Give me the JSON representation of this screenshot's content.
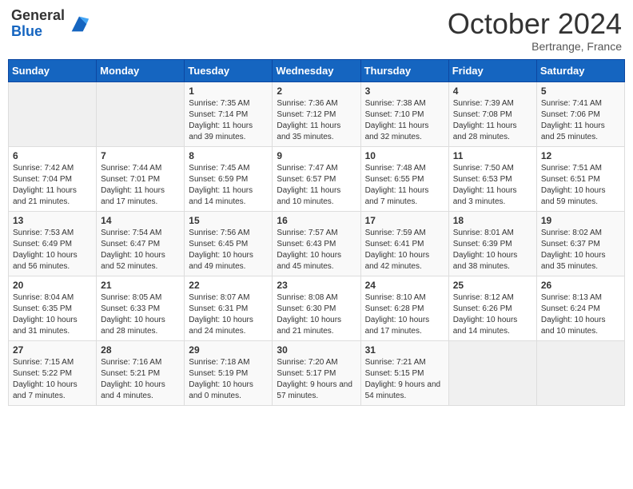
{
  "header": {
    "logo_general": "General",
    "logo_blue": "Blue",
    "month": "October 2024",
    "location": "Bertrange, France"
  },
  "days_of_week": [
    "Sunday",
    "Monday",
    "Tuesday",
    "Wednesday",
    "Thursday",
    "Friday",
    "Saturday"
  ],
  "weeks": [
    [
      {
        "day": "",
        "sunrise": "",
        "sunset": "",
        "daylight": ""
      },
      {
        "day": "",
        "sunrise": "",
        "sunset": "",
        "daylight": ""
      },
      {
        "day": "1",
        "sunrise": "Sunrise: 7:35 AM",
        "sunset": "Sunset: 7:14 PM",
        "daylight": "Daylight: 11 hours and 39 minutes."
      },
      {
        "day": "2",
        "sunrise": "Sunrise: 7:36 AM",
        "sunset": "Sunset: 7:12 PM",
        "daylight": "Daylight: 11 hours and 35 minutes."
      },
      {
        "day": "3",
        "sunrise": "Sunrise: 7:38 AM",
        "sunset": "Sunset: 7:10 PM",
        "daylight": "Daylight: 11 hours and 32 minutes."
      },
      {
        "day": "4",
        "sunrise": "Sunrise: 7:39 AM",
        "sunset": "Sunset: 7:08 PM",
        "daylight": "Daylight: 11 hours and 28 minutes."
      },
      {
        "day": "5",
        "sunrise": "Sunrise: 7:41 AM",
        "sunset": "Sunset: 7:06 PM",
        "daylight": "Daylight: 11 hours and 25 minutes."
      }
    ],
    [
      {
        "day": "6",
        "sunrise": "Sunrise: 7:42 AM",
        "sunset": "Sunset: 7:04 PM",
        "daylight": "Daylight: 11 hours and 21 minutes."
      },
      {
        "day": "7",
        "sunrise": "Sunrise: 7:44 AM",
        "sunset": "Sunset: 7:01 PM",
        "daylight": "Daylight: 11 hours and 17 minutes."
      },
      {
        "day": "8",
        "sunrise": "Sunrise: 7:45 AM",
        "sunset": "Sunset: 6:59 PM",
        "daylight": "Daylight: 11 hours and 14 minutes."
      },
      {
        "day": "9",
        "sunrise": "Sunrise: 7:47 AM",
        "sunset": "Sunset: 6:57 PM",
        "daylight": "Daylight: 11 hours and 10 minutes."
      },
      {
        "day": "10",
        "sunrise": "Sunrise: 7:48 AM",
        "sunset": "Sunset: 6:55 PM",
        "daylight": "Daylight: 11 hours and 7 minutes."
      },
      {
        "day": "11",
        "sunrise": "Sunrise: 7:50 AM",
        "sunset": "Sunset: 6:53 PM",
        "daylight": "Daylight: 11 hours and 3 minutes."
      },
      {
        "day": "12",
        "sunrise": "Sunrise: 7:51 AM",
        "sunset": "Sunset: 6:51 PM",
        "daylight": "Daylight: 10 hours and 59 minutes."
      }
    ],
    [
      {
        "day": "13",
        "sunrise": "Sunrise: 7:53 AM",
        "sunset": "Sunset: 6:49 PM",
        "daylight": "Daylight: 10 hours and 56 minutes."
      },
      {
        "day": "14",
        "sunrise": "Sunrise: 7:54 AM",
        "sunset": "Sunset: 6:47 PM",
        "daylight": "Daylight: 10 hours and 52 minutes."
      },
      {
        "day": "15",
        "sunrise": "Sunrise: 7:56 AM",
        "sunset": "Sunset: 6:45 PM",
        "daylight": "Daylight: 10 hours and 49 minutes."
      },
      {
        "day": "16",
        "sunrise": "Sunrise: 7:57 AM",
        "sunset": "Sunset: 6:43 PM",
        "daylight": "Daylight: 10 hours and 45 minutes."
      },
      {
        "day": "17",
        "sunrise": "Sunrise: 7:59 AM",
        "sunset": "Sunset: 6:41 PM",
        "daylight": "Daylight: 10 hours and 42 minutes."
      },
      {
        "day": "18",
        "sunrise": "Sunrise: 8:01 AM",
        "sunset": "Sunset: 6:39 PM",
        "daylight": "Daylight: 10 hours and 38 minutes."
      },
      {
        "day": "19",
        "sunrise": "Sunrise: 8:02 AM",
        "sunset": "Sunset: 6:37 PM",
        "daylight": "Daylight: 10 hours and 35 minutes."
      }
    ],
    [
      {
        "day": "20",
        "sunrise": "Sunrise: 8:04 AM",
        "sunset": "Sunset: 6:35 PM",
        "daylight": "Daylight: 10 hours and 31 minutes."
      },
      {
        "day": "21",
        "sunrise": "Sunrise: 8:05 AM",
        "sunset": "Sunset: 6:33 PM",
        "daylight": "Daylight: 10 hours and 28 minutes."
      },
      {
        "day": "22",
        "sunrise": "Sunrise: 8:07 AM",
        "sunset": "Sunset: 6:31 PM",
        "daylight": "Daylight: 10 hours and 24 minutes."
      },
      {
        "day": "23",
        "sunrise": "Sunrise: 8:08 AM",
        "sunset": "Sunset: 6:30 PM",
        "daylight": "Daylight: 10 hours and 21 minutes."
      },
      {
        "day": "24",
        "sunrise": "Sunrise: 8:10 AM",
        "sunset": "Sunset: 6:28 PM",
        "daylight": "Daylight: 10 hours and 17 minutes."
      },
      {
        "day": "25",
        "sunrise": "Sunrise: 8:12 AM",
        "sunset": "Sunset: 6:26 PM",
        "daylight": "Daylight: 10 hours and 14 minutes."
      },
      {
        "day": "26",
        "sunrise": "Sunrise: 8:13 AM",
        "sunset": "Sunset: 6:24 PM",
        "daylight": "Daylight: 10 hours and 10 minutes."
      }
    ],
    [
      {
        "day": "27",
        "sunrise": "Sunrise: 7:15 AM",
        "sunset": "Sunset: 5:22 PM",
        "daylight": "Daylight: 10 hours and 7 minutes."
      },
      {
        "day": "28",
        "sunrise": "Sunrise: 7:16 AM",
        "sunset": "Sunset: 5:21 PM",
        "daylight": "Daylight: 10 hours and 4 minutes."
      },
      {
        "day": "29",
        "sunrise": "Sunrise: 7:18 AM",
        "sunset": "Sunset: 5:19 PM",
        "daylight": "Daylight: 10 hours and 0 minutes."
      },
      {
        "day": "30",
        "sunrise": "Sunrise: 7:20 AM",
        "sunset": "Sunset: 5:17 PM",
        "daylight": "Daylight: 9 hours and 57 minutes."
      },
      {
        "day": "31",
        "sunrise": "Sunrise: 7:21 AM",
        "sunset": "Sunset: 5:15 PM",
        "daylight": "Daylight: 9 hours and 54 minutes."
      },
      {
        "day": "",
        "sunrise": "",
        "sunset": "",
        "daylight": ""
      },
      {
        "day": "",
        "sunrise": "",
        "sunset": "",
        "daylight": ""
      }
    ]
  ]
}
